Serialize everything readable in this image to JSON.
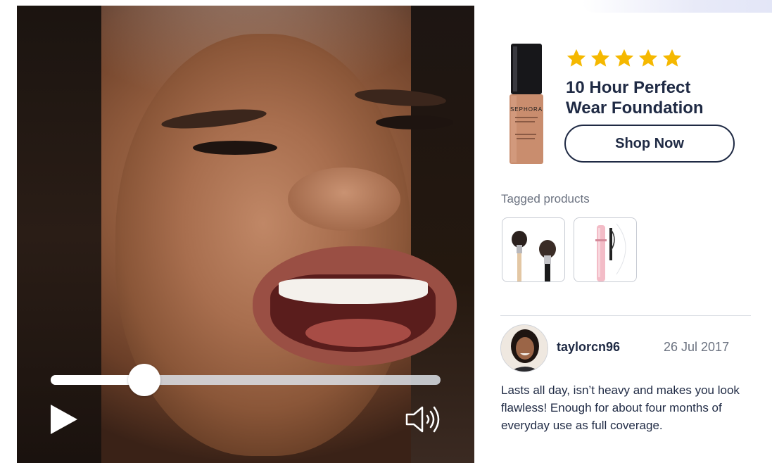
{
  "video": {
    "progress_fraction": 0.24
  },
  "product": {
    "brand": "SEPHORA",
    "rating_stars": 5,
    "star_color": "#f5b800",
    "title": "10 Hour Perfect Wear Foundation",
    "shop_button_label": "Shop Now"
  },
  "tagged": {
    "label": "Tagged products",
    "items": [
      {
        "icon": "makeup-brushes-icon"
      },
      {
        "icon": "mascara-icon"
      }
    ]
  },
  "review": {
    "username": "taylorcn96",
    "date": "26 Jul 2017",
    "text": "Lasts all day, isn’t heavy and makes you look flawless! Enough for about four months of everyday use as full coverage."
  },
  "colors": {
    "text_primary": "#1f2a44",
    "text_secondary": "#6b7280",
    "accent_star": "#f5b800"
  }
}
